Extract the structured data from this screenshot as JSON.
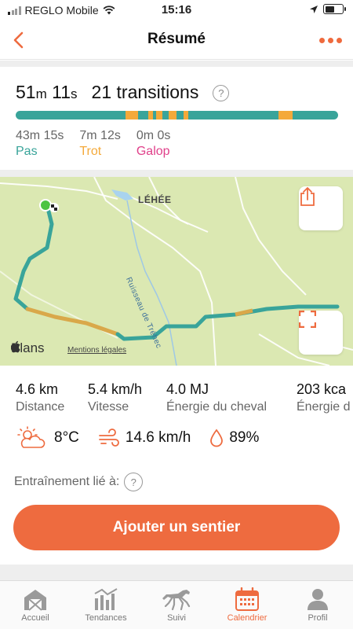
{
  "status_bar": {
    "carrier": "REGLO Mobile",
    "time": "15:16"
  },
  "nav": {
    "title": "Résumé",
    "back_icon": "chevron-left-icon",
    "more_icon": "more-dots-icon"
  },
  "summary": {
    "duration_min": "51",
    "duration_min_unit": "m",
    "duration_sec": "11",
    "duration_sec_unit": "s",
    "transitions": "21 transitions",
    "help_symbol": "?"
  },
  "gait_bar": {
    "colors": {
      "pas": "#39a49a",
      "trot": "#f4a93a",
      "galop": "#e0408a"
    },
    "segments": [
      {
        "gait": "trot",
        "start": 0.34,
        "end": 0.38
      },
      {
        "gait": "trot",
        "start": 0.41,
        "end": 0.425
      },
      {
        "gait": "trot",
        "start": 0.435,
        "end": 0.455
      },
      {
        "gait": "trot",
        "start": 0.475,
        "end": 0.5
      },
      {
        "gait": "trot",
        "start": 0.52,
        "end": 0.535
      },
      {
        "gait": "trot",
        "start": 0.815,
        "end": 0.86
      }
    ]
  },
  "gaits": [
    {
      "time": "43m 15s",
      "label": "Pas",
      "color": "#39a49a"
    },
    {
      "time": "7m 12s",
      "label": "Trot",
      "color": "#f4a93a"
    },
    {
      "time": "0m 0s",
      "label": "Galop",
      "color": "#e0408a"
    }
  ],
  "map": {
    "place_label": "LÉHÉE",
    "river_label": "Ruisseau de Tréhec",
    "plans_label": "Plans",
    "legal_label": "Mentions légales",
    "share_icon": "share-icon",
    "fullscreen_icon": "fullscreen-icon"
  },
  "stats": [
    {
      "value": "4.6 km",
      "label": "Distance"
    },
    {
      "value": "5.4 km/h",
      "label": "Vitesse"
    },
    {
      "value": "4.0 MJ",
      "label": "Énergie du cheval"
    },
    {
      "value": "203 kca",
      "label": "Énergie d"
    }
  ],
  "weather": {
    "temperature": "8°C",
    "temperature_icon": "partly-cloudy-icon",
    "wind": "14.6 km/h",
    "wind_icon": "wind-icon",
    "humidity": "89%",
    "humidity_icon": "droplet-icon"
  },
  "linked": {
    "label": "Entraînement lié à:",
    "help_symbol": "?"
  },
  "add_trail_label": "Ajouter un sentier",
  "accent_color": "#ee6b3f",
  "tabs": [
    {
      "label": "Accueil",
      "icon": "barn-icon"
    },
    {
      "label": "Tendances",
      "icon": "trends-icon"
    },
    {
      "label": "Suivi",
      "icon": "horse-icon"
    },
    {
      "label": "Calendrier",
      "icon": "calendar-icon"
    },
    {
      "label": "Profil",
      "icon": "profile-icon"
    }
  ]
}
